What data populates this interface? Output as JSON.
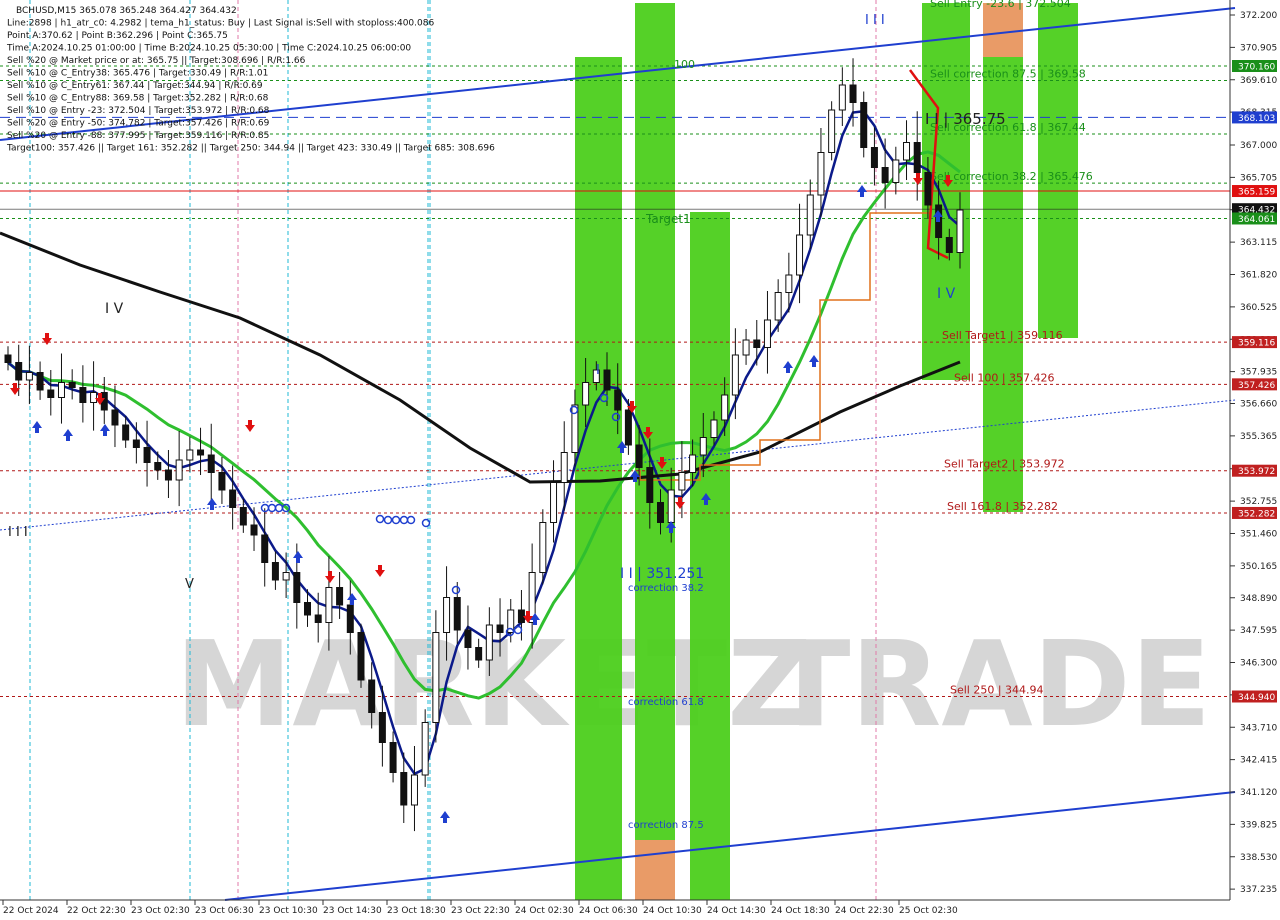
{
  "info_lines": [
    "BCHUSD,M15  365.078 365.248 364.427 364.432",
    "Line:2898  | h1_atr_c0: 4.2982 | tema_h1_status: Buy | Last Signal is:Sell with stoploss:400.086",
    "Point A:370.62 | Point B:362.296 | Point C:365.75",
    "Time A:2024.10.25 01:00:00 | Time B:2024.10.25 05:30:00 | Time C:2024.10.25 06:00:00",
    "Sell %20 @ Market price or at: 365.75 || Target:308.696 | R/R:1.66",
    "Sell %10 @ C_Entry38: 365.476 | Target:330.49 | R/R:1.01",
    "Sell %10 @ C_Entry61: 367.44 | Target:344.94 | R/R:0.69",
    "Sell %10 @ C_Entry88: 369.58 | Target:352.282 | R/R:0.68",
    "Sell %10 @ Entry -23: 372.504 | Target:353.972 | R/R:0.68",
    "Sell %20 @ Entry -50: 374.782 | Target:357.426 | R/R:0.69",
    "Sell %20 @ Entry -88: 377.995 | Target:359.116 | R/R:0.85",
    "Target100: 357.426 || Target 161: 352.282 || Target 250: 344.94 || Target 423: 330.49 || Target 685: 308.696"
  ],
  "watermark": {
    "left": "MARKETZ",
    "right": "TRADE"
  },
  "chart_data": {
    "type": "candlestick",
    "symbol": "BCHUSD",
    "timeframe": "M15",
    "ylim": [
      336.8,
      372.8
    ],
    "y_ticks": [
      "372.200",
      "370.905",
      "369.610",
      "368.315",
      "367.000",
      "365.705",
      "364.410",
      "363.115",
      "361.820",
      "360.525",
      "359.230",
      "357.935",
      "356.660",
      "355.365",
      "354.050",
      "352.755",
      "351.460",
      "350.165",
      "348.890",
      "347.595",
      "346.300",
      "345.005",
      "343.710",
      "342.415",
      "341.120",
      "339.825",
      "338.530",
      "337.235"
    ],
    "x_ticks": [
      "22 Oct 2024",
      "22 Oct 22:30",
      "23 Oct 02:30",
      "23 Oct 06:30",
      "23 Oct 10:30",
      "23 Oct 14:30",
      "23 Oct 18:30",
      "23 Oct 22:30",
      "24 Oct 02:30",
      "24 Oct 06:30",
      "24 Oct 10:30",
      "24 Oct 14:30",
      "24 Oct 18:30",
      "24 Oct 22:30",
      "25 Oct 02:30"
    ],
    "price_path": [
      358.3,
      357.6,
      357.9,
      357.2,
      356.9,
      357.5,
      357.3,
      356.7,
      357.1,
      356.4,
      355.8,
      355.2,
      354.9,
      354.3,
      354.0,
      353.6,
      354.4,
      354.8,
      354.6,
      353.9,
      353.2,
      352.5,
      351.8,
      351.4,
      350.3,
      349.6,
      349.9,
      348.7,
      348.2,
      347.9,
      349.3,
      348.6,
      347.5,
      345.6,
      344.3,
      343.1,
      341.9,
      340.6,
      341.8,
      343.9,
      347.5,
      348.9,
      347.6,
      346.9,
      346.4,
      347.8,
      347.5,
      348.4,
      347.9,
      349.9,
      351.9,
      353.5,
      354.7,
      356.6,
      357.5,
      358.0,
      357.2,
      356.4,
      355.0,
      354.1,
      352.7,
      351.9,
      353.2,
      353.9,
      354.6,
      355.3,
      356.0,
      357.0,
      358.6,
      359.2,
      358.9,
      360.0,
      361.1,
      361.8,
      363.4,
      365.0,
      366.7,
      368.4,
      369.4,
      368.7,
      366.9,
      366.1,
      365.5,
      366.4,
      367.1,
      365.9,
      364.6,
      363.3,
      362.7,
      364.4
    ],
    "levels": [
      {
        "price": "370.160",
        "label": "Sell Entry -23.6 | 372.504",
        "color": "#1a8f1a"
      },
      {
        "price": "369.580",
        "label": "Sell correction 87.5 | 369.58",
        "color": "#1a8f1a"
      },
      {
        "price": "368.103",
        "label": "",
        "color": "#1f3fcf"
      },
      {
        "price": "367.440",
        "label": "Sell correction 61.8 | 367.44",
        "color": "#1a8f1a"
      },
      {
        "price": "365.476",
        "label": "Sell correction 38.2 | 365.476",
        "color": "#1a8f1a"
      },
      {
        "price": "365.159",
        "label": "",
        "color": "#e01010"
      },
      {
        "price": "364.432",
        "label": "",
        "color": "#222222"
      },
      {
        "price": "364.061",
        "label": "",
        "color": "#1a8f1a"
      },
      {
        "price": "359.116",
        "label": "Sell Target1 | 359.116",
        "color": "#b01818"
      },
      {
        "price": "357.426",
        "label": "Sell 100 | 357.426",
        "color": "#b01818"
      },
      {
        "price": "353.972",
        "label": "Sell Target2 | 353.972",
        "color": "#b01818"
      },
      {
        "price": "352.282",
        "label": "Sell 161.8 | 352.282",
        "color": "#b01818"
      },
      {
        "price": "344.940",
        "label": "Sell 250 | 344.94",
        "color": "#b01818"
      }
    ],
    "price_tags": [
      {
        "price": "370.160",
        "color": "#1a8f1a"
      },
      {
        "price": "368.103",
        "color": "#1f3fcf"
      },
      {
        "price": "365.159",
        "color": "#e01010"
      },
      {
        "price": "364.432",
        "color": "#111111"
      },
      {
        "price": "364.061",
        "color": "#1a8f1a"
      },
      {
        "price": "359.116",
        "color": "#c02020"
      },
      {
        "price": "357.426",
        "color": "#c02020"
      },
      {
        "price": "353.972",
        "color": "#c02020"
      },
      {
        "price": "352.282",
        "color": "#c02020"
      },
      {
        "price": "344.940",
        "color": "#c02020"
      }
    ],
    "annotations": [
      {
        "text": "I I I",
        "color": "#1f3fcf"
      },
      {
        "text": "I V",
        "color": "#222222"
      },
      {
        "text": "V",
        "color": "#222222"
      },
      {
        "text": "I",
        "color": "#1f3fcf"
      },
      {
        "text": "I I I",
        "color": "#222222"
      },
      {
        "text": "I V",
        "color": "#1f3fcf"
      },
      {
        "text": "I I | 351.251",
        "color": "#1f3fcf"
      },
      {
        "text": "I I | 365.75",
        "color": "#222222"
      },
      {
        "text": "Target1",
        "color": "#1a8f1a"
      },
      {
        "text": "100",
        "color": "#1a8f1a"
      },
      {
        "text": "correction 38.2",
        "color": "#1f3fcf"
      },
      {
        "text": "correction 61.8",
        "color": "#1f3fcf"
      },
      {
        "text": "correction 87.5",
        "color": "#1f3fcf"
      }
    ]
  }
}
